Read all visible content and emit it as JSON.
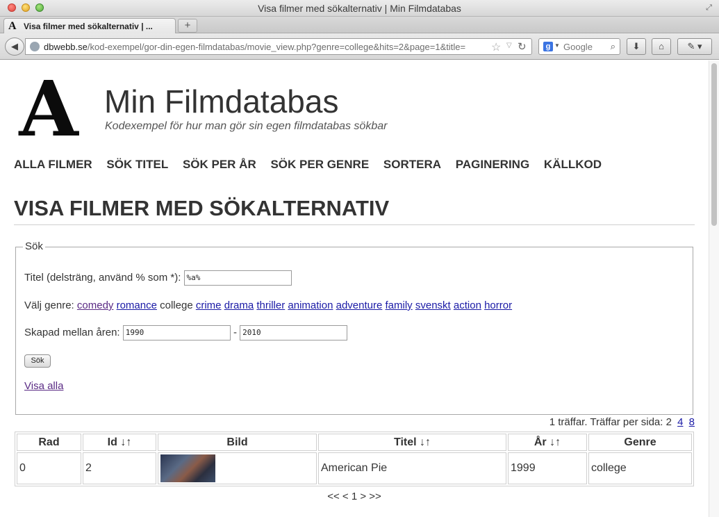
{
  "browser": {
    "window_title": "Visa filmer med sökalternativ | Min Filmdatabas",
    "tab_label": "Visa filmer med sökalternativ | ...",
    "url_host": "dbwebb.se",
    "url_path": "/kod-exempel/gor-din-egen-filmdatabas/movie_view.php?genre=college&hits=2&page=1&title=",
    "search_placeholder": "Google",
    "favicon_letter": "A"
  },
  "site": {
    "logo_letter": "A",
    "title": "Min Filmdatabas",
    "slogan": "Kodexempel för hur man gör sin egen filmdatabas sökbar"
  },
  "nav": {
    "items": [
      "ALLA FILMER",
      "SÖK TITEL",
      "SÖK PER ÅR",
      "SÖK PER GENRE",
      "SORTERA",
      "PAGINERING",
      "KÄLLKOD"
    ]
  },
  "page": {
    "heading": "VISA FILMER MED SÖKALTERNATIV"
  },
  "form": {
    "legend": "Sök",
    "title_label": "Titel (delsträng, använd % som *):",
    "title_value": "%a%",
    "genre_label": "Välj genre:",
    "genres": [
      "comedy",
      "romance",
      "college",
      "crime",
      "drama",
      "thriller",
      "animation",
      "adventure",
      "family",
      "svenskt",
      "action",
      "horror"
    ],
    "year_label": "Skapad mellan åren:",
    "year_from": "1990",
    "year_separator": "-",
    "year_to": "2010",
    "submit_label": "Sök",
    "show_all_label": "Visa alla"
  },
  "results": {
    "hits_text": "1 träffar. Träffar per sida: 2",
    "per_page_links": [
      "4",
      "8"
    ],
    "headers": [
      "Rad",
      "Id ↓↑",
      "Bild",
      "Titel ↓↑",
      "År ↓↑",
      "Genre"
    ],
    "rows": [
      {
        "rad": "0",
        "id": "2",
        "titel": "American Pie",
        "ar": "1999",
        "genre": "college"
      }
    ],
    "pager": "<< < 1 > >>"
  }
}
